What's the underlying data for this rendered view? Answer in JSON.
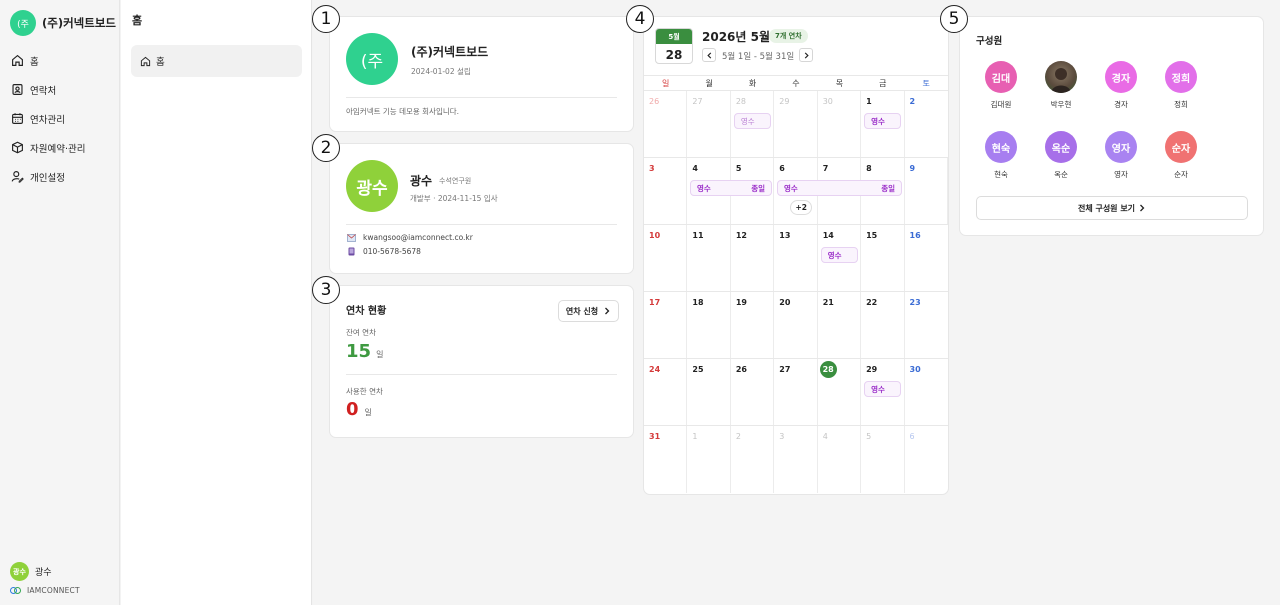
{
  "app": {
    "company_logo": "(주",
    "company_name": "(주)커넥트보드"
  },
  "nav": [
    {
      "label": "홈",
      "icon": "home-icon"
    },
    {
      "label": "연락처",
      "icon": "contacts-icon"
    },
    {
      "label": "연차관리",
      "icon": "calendar-icon"
    },
    {
      "label": "자원예약·관리",
      "icon": "box-icon"
    },
    {
      "label": "개인설정",
      "icon": "user-settings-icon"
    }
  ],
  "footer": {
    "user_avatar": "광수",
    "user_name": "광수",
    "company": "IAMCONNECT"
  },
  "subnav": {
    "title": "홈",
    "item": "홈"
  },
  "markers": [
    "1",
    "2",
    "3",
    "4",
    "5"
  ],
  "company_card": {
    "logo": "(주",
    "name": "(주)커넥트보드",
    "founded": "2024-01-02 설립",
    "description": "아임커넥트 기능 데모용 회사입니다."
  },
  "profile_card": {
    "avatar": "광수",
    "name": "광수",
    "position": "수석연구원",
    "meta": "개발부 · 2024-11-15 입사",
    "email": "kwangsoo@iamconnect.co.kr",
    "phone": "010-5678-5678"
  },
  "leave_card": {
    "title": "연차 현황",
    "apply_label": "연차 신청",
    "remaining_label": "잔여 연차",
    "remaining_value": "15",
    "remaining_unit": "일",
    "used_label": "사용한 연차",
    "used_value": "0",
    "used_unit": "일"
  },
  "calendar": {
    "badge_month": "5월",
    "badge_day": "28",
    "title": "2026년 5월",
    "count_badge": "7개 연차",
    "range": "5월 1일 - 5월 31일",
    "dow": [
      "일",
      "월",
      "화",
      "수",
      "목",
      "금",
      "토"
    ],
    "weeks": [
      [
        "26",
        "27",
        "28",
        "29",
        "30",
        "1",
        "2"
      ],
      [
        "3",
        "4",
        "5",
        "6",
        "7",
        "8",
        "9"
      ],
      [
        "10",
        "11",
        "12",
        "13",
        "14",
        "15",
        "16"
      ],
      [
        "17",
        "18",
        "19",
        "20",
        "21",
        "22",
        "23"
      ],
      [
        "24",
        "25",
        "26",
        "27",
        "28",
        "29",
        "30"
      ],
      [
        "31",
        "1",
        "2",
        "3",
        "4",
        "5",
        "6"
      ]
    ],
    "events": {
      "e1": "영수",
      "e2": "영수",
      "e3": "영수",
      "e3_end": "종일",
      "e4": "영수",
      "e4_end": "종일",
      "more": "+2",
      "e5": "영수",
      "e6": "영수"
    }
  },
  "members": {
    "title": "구성원",
    "list": [
      {
        "avatar": "김대",
        "name": "김대원",
        "color": "#e75fb2"
      },
      {
        "avatar": "",
        "name": "박우현",
        "color": "#6b5a4a"
      },
      {
        "avatar": "경자",
        "name": "경자",
        "color": "#e96be5"
      },
      {
        "avatar": "정희",
        "name": "정희",
        "color": "#e26fe9"
      },
      {
        "avatar": "현숙",
        "name": "현숙",
        "color": "#a77ef0"
      },
      {
        "avatar": "옥순",
        "name": "옥순",
        "color": "#a76fe9"
      },
      {
        "avatar": "영자",
        "name": "영자",
        "color": "#a983f1"
      },
      {
        "avatar": "순자",
        "name": "순자",
        "color": "#f07272"
      }
    ],
    "view_all": "전체 구성원 보기"
  }
}
